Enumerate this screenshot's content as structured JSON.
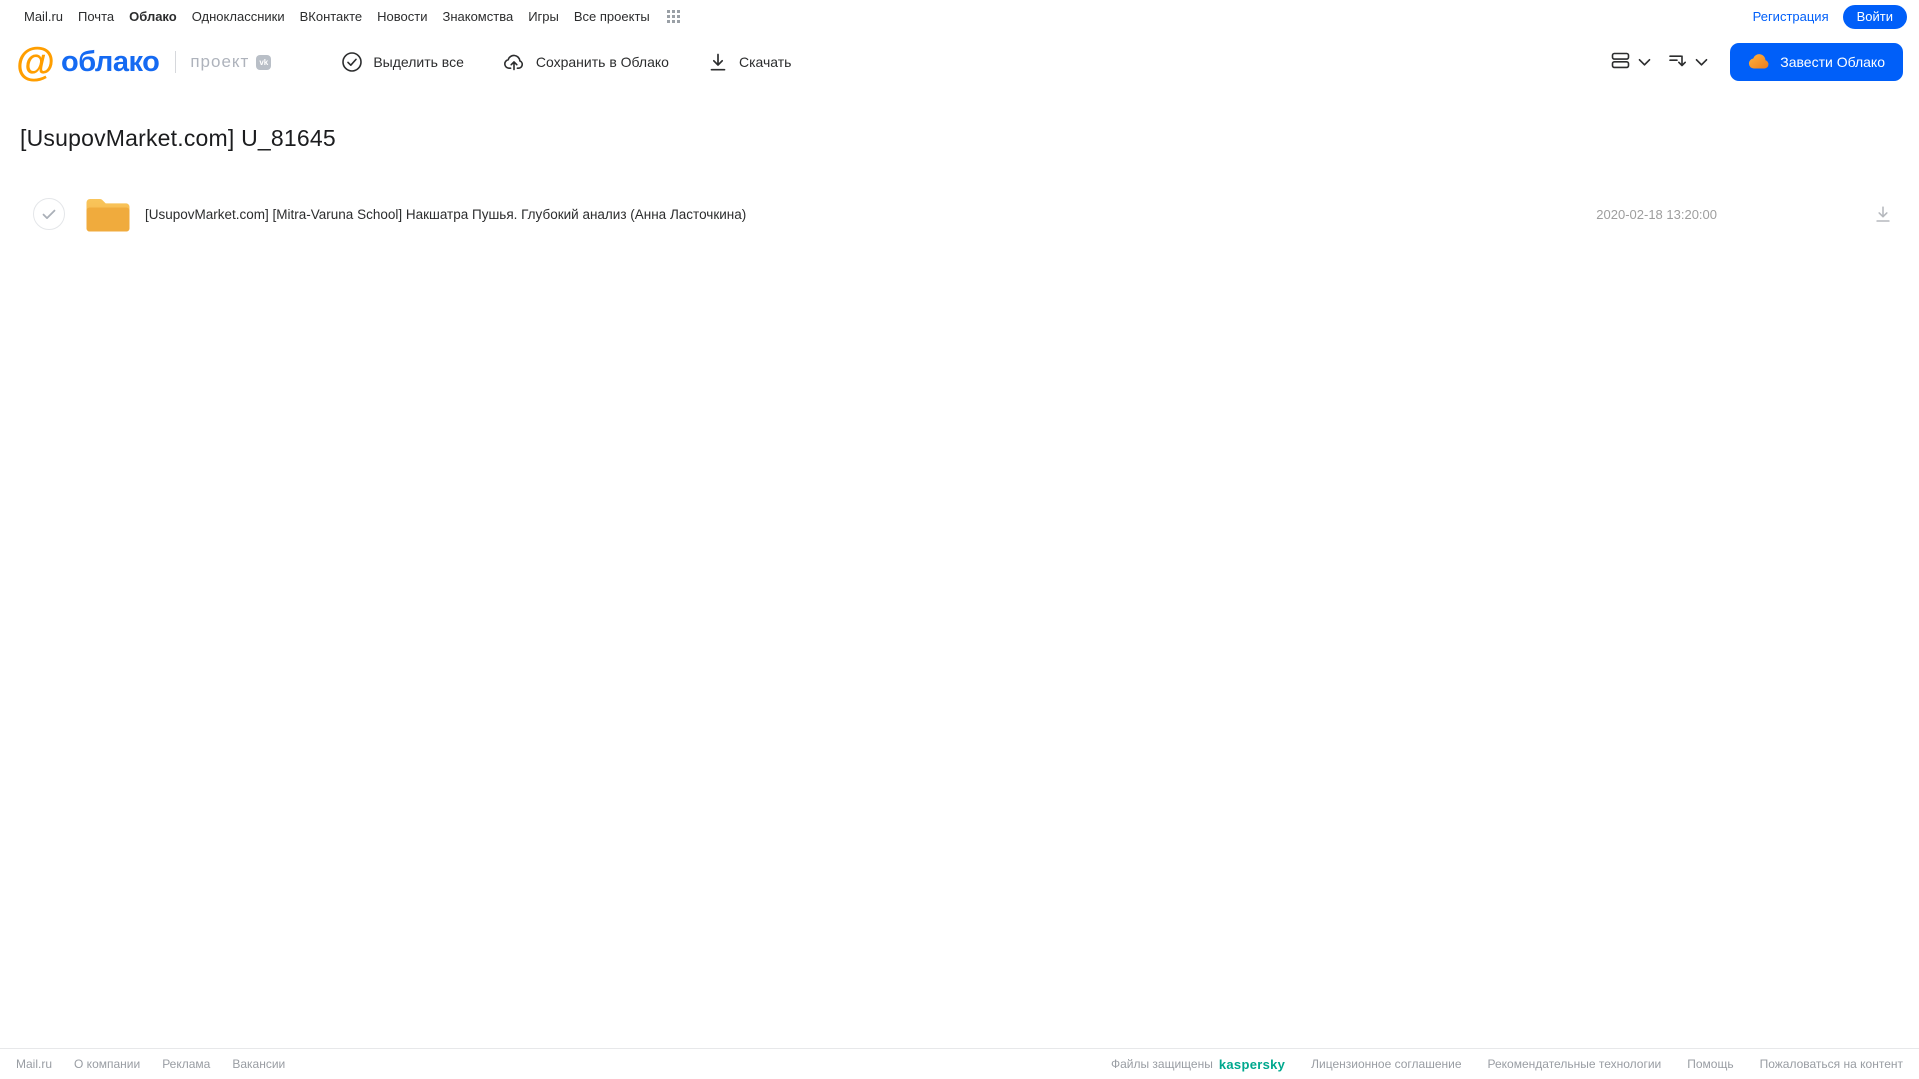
{
  "topnav": {
    "items": [
      "Mail.ru",
      "Почта",
      "Облако",
      "Одноклассники",
      "ВКонтакте",
      "Новости",
      "Знакомства",
      "Игры",
      "Все проекты"
    ],
    "registration_label": "Регистрация",
    "login_label": "Войти"
  },
  "header": {
    "logo_at": "@",
    "logo_text": "облако",
    "project_label": "проект",
    "vk_badge": "vk",
    "select_all_label": "Выделить все",
    "save_to_cloud_label": "Сохранить в Облако",
    "download_label": "Скачать",
    "get_cloud_label": "Завести Облако"
  },
  "main": {
    "title": "[UsupovMarket.com] U_81645",
    "files": [
      {
        "type": "folder",
        "name": "[UsupovMarket.com] [Mitra-Varuna School] Накшатра Пушья. Глубокий анализ (Анна Ласточкина)",
        "modified": "2020-02-18 13:20:00"
      }
    ]
  },
  "footer": {
    "links_left": [
      "Mail.ru",
      "О компании",
      "Реклама",
      "Вакансии"
    ],
    "protected_by_label": "Файлы защищены",
    "kaspersky_label": "kaspersky",
    "links_right": [
      "Лицензионное соглашение",
      "Рекомендательные технологии",
      "Помощь",
      "Пожаловаться на контент"
    ]
  },
  "colors": {
    "accent_blue": "#005ff9",
    "logo_orange": "#ff9e00",
    "logo_blue": "#156af2",
    "folder_amber_top": "#f9c55b",
    "folder_amber_bottom": "#eda234",
    "kaspersky_green": "#00a88e",
    "text_dark": "#2c2d2e",
    "text_gray": "#9e9e9e"
  }
}
